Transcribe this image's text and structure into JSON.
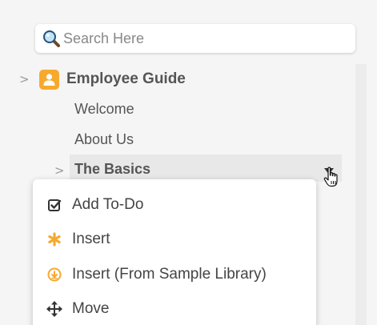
{
  "search": {
    "placeholder": "Search Here",
    "value": ""
  },
  "tree": {
    "root": {
      "expander": ">",
      "label": "Employee Guide",
      "icon": "person-book-icon",
      "icon_color": "#f7a92e"
    },
    "children": [
      {
        "label": "Welcome"
      },
      {
        "label": "About Us"
      }
    ],
    "selected": {
      "expander": ">",
      "label": "The Basics"
    }
  },
  "context_menu": {
    "items": [
      {
        "label": "Add To-Do",
        "icon": "checkbox-icon"
      },
      {
        "label": "Insert",
        "icon": "asterisk-icon",
        "icon_color": "#f7a92e"
      },
      {
        "label": "Insert (From Sample Library)",
        "icon": "download-circle-icon",
        "icon_color": "#f7a92e"
      },
      {
        "label": "Move",
        "icon": "move-arrows-icon"
      }
    ]
  }
}
